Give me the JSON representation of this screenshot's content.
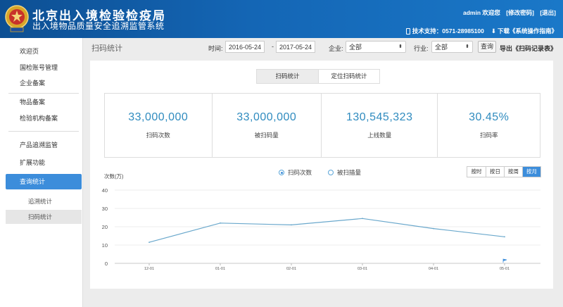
{
  "header": {
    "title_main": "北京出入境检验检疫局",
    "title_sub": "出入境物品质量安全追溯监管系统",
    "user_welcome": "admin 欢迎您",
    "change_password": "[修改密码]",
    "logout": "[退出]",
    "support": "技术支持：0571-28985100",
    "download_guide": "下载《系统操作指南》"
  },
  "sidebar": {
    "items": [
      {
        "label": "欢迎页"
      },
      {
        "label": "国检账号管理"
      },
      {
        "label": "企业备案"
      },
      {
        "label": "物品备案"
      },
      {
        "label": "检验机构备案"
      },
      {
        "label": "产品追溯监管"
      },
      {
        "label": "扩展功能"
      },
      {
        "label": "查询统计"
      }
    ],
    "sub_items": [
      {
        "label": "追溯统计"
      },
      {
        "label": "扫码统计"
      }
    ]
  },
  "toolbar": {
    "page_title": "扫码统计",
    "time_label": "时间:",
    "date_from": "2016-05-24",
    "date_sep": "-",
    "date_to": "2017-05-24",
    "company_label": "企业:",
    "company_value": "全部",
    "industry_label": "行业:",
    "industry_value": "全部",
    "query_button": "查询",
    "export_link": "导出《扫码记录表》"
  },
  "tabs": [
    {
      "label": "扫码统计"
    },
    {
      "label": "定位扫码统计"
    }
  ],
  "stats": [
    {
      "value": "33,000,000",
      "label": "扫码次数"
    },
    {
      "value": "33,000,000",
      "label": "被扫码量"
    },
    {
      "value": "130,545,323",
      "label": "上线数量"
    },
    {
      "value": "30.45%",
      "label": "扫码率"
    }
  ],
  "legend": [
    {
      "label": "扫码次数",
      "selected": true
    },
    {
      "label": "被扫描量",
      "selected": false
    }
  ],
  "period_buttons": [
    {
      "label": "按时"
    },
    {
      "label": "按日"
    },
    {
      "label": "按周"
    },
    {
      "label": "按月"
    }
  ],
  "colors": {
    "accent": "#3c8ddb",
    "line": "#6aa8cc",
    "header": "#1466b5"
  },
  "chart_data": {
    "type": "line",
    "ylabel": "次数(万)",
    "ylim": [
      0,
      40
    ],
    "yticks": [
      0,
      10,
      20,
      30,
      40
    ],
    "categories": [
      "12-01",
      "01-01",
      "02-01",
      "03-01",
      "04-01",
      "05-01"
    ],
    "series": [
      {
        "name": "扫码次数",
        "values": [
          11.5,
          22,
          21,
          24.5,
          19,
          14.5
        ]
      }
    ],
    "grid": "horizontal"
  }
}
